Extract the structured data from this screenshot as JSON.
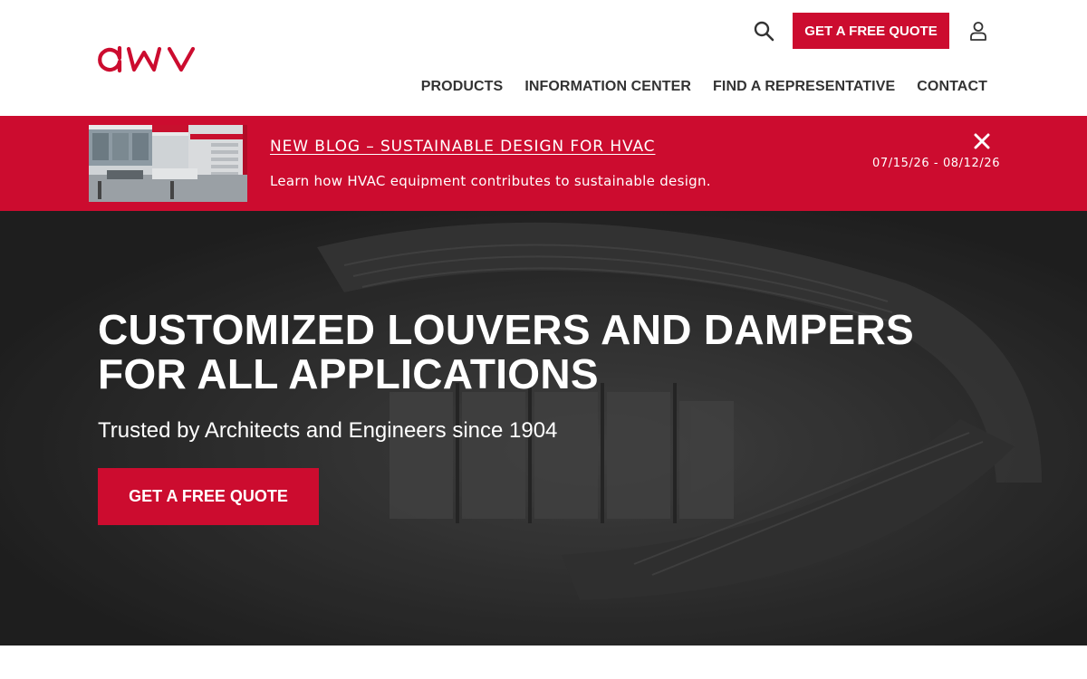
{
  "brand": {
    "logo_text": "awv",
    "accent_color": "#cc0c2f"
  },
  "header": {
    "search_icon": "search-icon",
    "quote_button": "GET A FREE QUOTE",
    "user_icon": "user-icon",
    "nav": [
      {
        "label": "PRODUCTS"
      },
      {
        "label": "INFORMATION CENTER"
      },
      {
        "label": "FIND A REPRESENTATIVE"
      },
      {
        "label": "CONTACT"
      }
    ]
  },
  "alert": {
    "title": "NEW BLOG – SUSTAINABLE DESIGN FOR HVAC",
    "description": "Learn how HVAC equipment contributes to sustainable design.",
    "dates": "07/15/26 - 08/12/26",
    "close_icon": "close-icon",
    "background_color": "#cc0c2f"
  },
  "hero": {
    "title_lines": [
      "CUSTOMIZED LOUVERS AND DAMPERS",
      "FOR ALL APPLICATIONS"
    ],
    "subtitle": "Trusted by Architects and Engineers since 1904",
    "cta": "GET A FREE QUOTE"
  }
}
